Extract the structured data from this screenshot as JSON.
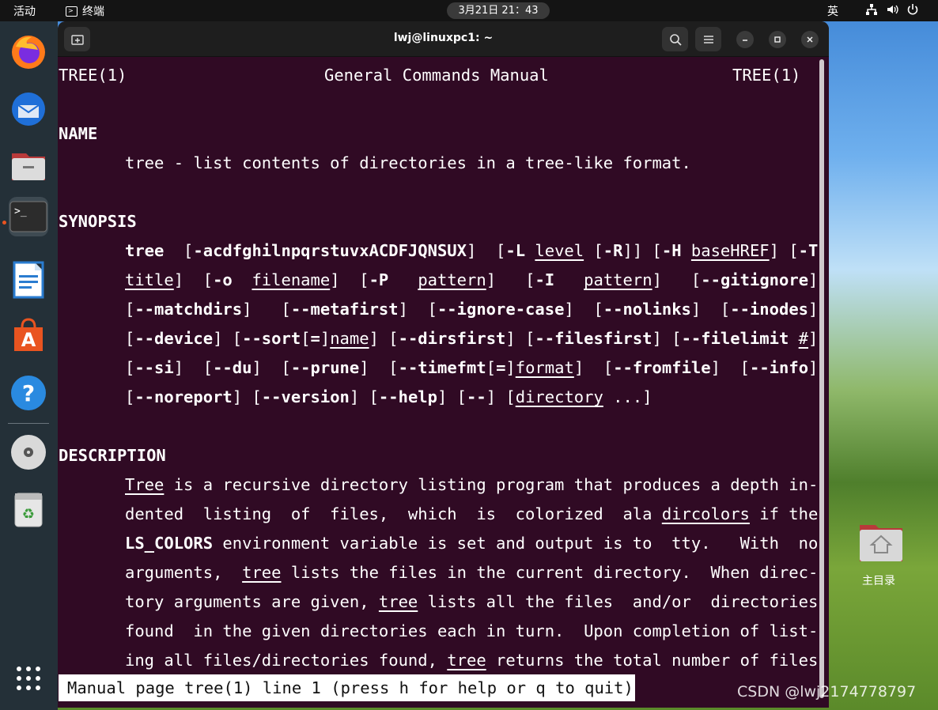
{
  "topbar": {
    "activities": "活动",
    "app_name": "终端",
    "clock": "3月21日  21：43",
    "ime": "英"
  },
  "window": {
    "title": "lwj@linuxpc1: ~"
  },
  "dock": {
    "items": [
      "firefox",
      "thunderbird",
      "files",
      "terminal",
      "writer",
      "app-center",
      "help",
      "disc",
      "trash",
      "show-apps"
    ]
  },
  "man": {
    "header_left": "TREE(1)",
    "header_center": "General Commands Manual",
    "header_right": "TREE(1)",
    "name_heading": "NAME",
    "name_text": "tree - list contents of directories in a tree-like format.",
    "synopsis_heading": "SYNOPSIS",
    "description_heading": "DESCRIPTION"
  },
  "status": {
    "text": "Manual page tree(1) line 1 (press h for help or q to quit)"
  },
  "desktop": {
    "home_label": "主目录",
    "watermark": "CSDN @lwj2174778797"
  }
}
